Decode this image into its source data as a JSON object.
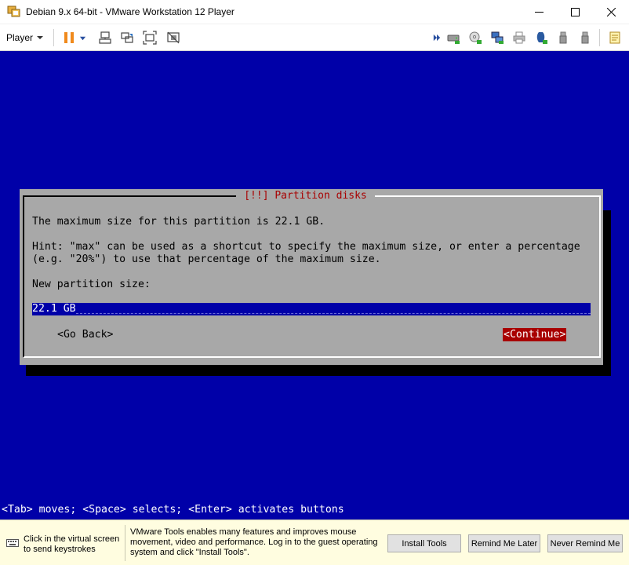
{
  "window": {
    "title": "Debian 9.x 64-bit - VMware Workstation 12 Player"
  },
  "toolbar": {
    "player_label": "Player",
    "icons": [
      "pause-icon",
      "dropdown-icon",
      "send-ctrl-alt-del-icon",
      "unity-icon",
      "full-screen-icon",
      "unity-mode-icon",
      "forward-icon",
      "hard-disk-icon",
      "cd-dvd-icon",
      "network-adapter-icon",
      "printer-icon",
      "sound-card-icon",
      "usb-icon",
      "usb-device-icon",
      "message-log-icon"
    ]
  },
  "installer": {
    "dialog_title": "[!!] Partition disks",
    "max_size_text": "The maximum size for this partition is 22.1 GB.",
    "hint_line1": "Hint: \"max\" can be used as a shortcut to specify the maximum size, or enter a percentage",
    "hint_line2": "(e.g. \"20%\") to use that percentage of the maximum size.",
    "prompt": "New partition size:",
    "input_value": "22.1 GB",
    "back_label": "<Go Back>",
    "continue_label": "<Continue>",
    "status_line": "<Tab> moves; <Space> selects; <Enter> activates buttons",
    "colors": {
      "background": "#0000a8",
      "dialog": "#a8a8a8",
      "title": "#a80000",
      "selected_button": "#a80000"
    }
  },
  "notification": {
    "keystroke_hint": "Click in the virtual screen to send keystrokes",
    "tools_message": "VMware Tools enables many features and improves mouse movement, video and performance. Log in to the guest operating system and click \"Install Tools\".",
    "install_label": "Install Tools",
    "remind_later_label": "Remind Me Later",
    "never_remind_label": "Never Remind Me"
  }
}
